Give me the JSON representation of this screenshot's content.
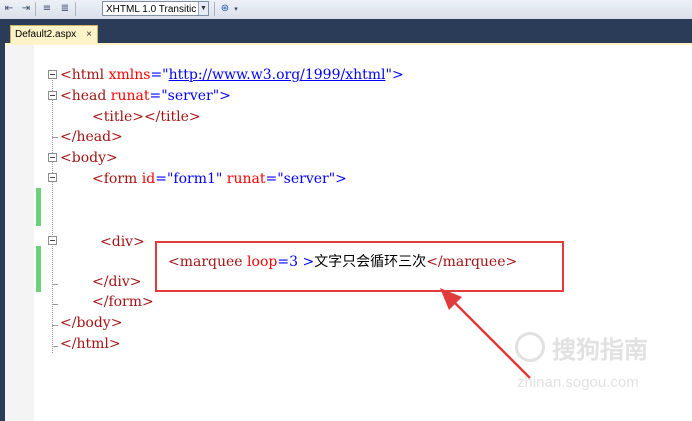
{
  "toolbar": {
    "doctype_value": "XHTML 1.0 Transitic",
    "icons": [
      "outdent-icon",
      "indent-icon",
      "comment-icon",
      "uncomment-icon",
      "validate-icon"
    ]
  },
  "tabs": [
    {
      "label": "Default2.aspx",
      "close": "×",
      "active": true
    }
  ],
  "code": {
    "l1": {
      "open": "<html ",
      "attr": "xmlns",
      "eq": "=\"",
      "url": "http://www.w3.org/1999/xhtml",
      "close": "\">"
    },
    "l2": {
      "open": "<head ",
      "attr": "runat",
      "eq": "=",
      "val": "\"server\"",
      "close": ">"
    },
    "l3": {
      "text": "<title></title>"
    },
    "l4": {
      "text": "</head>"
    },
    "l5": {
      "text": "<body>"
    },
    "l6": {
      "open": "<form ",
      "attr1": "id",
      "eq1": "=",
      "val1": "\"form1\"",
      "attr2": " runat",
      "eq2": "=",
      "val2": "\"server\"",
      "close": ">"
    },
    "l7": {
      "text": "<div>"
    },
    "l8": {
      "open": "<marquee ",
      "attr": "loop",
      "eq": "=",
      "val": "3",
      "close": " >",
      "content": "文字只会循环三次",
      "end": "</marquee>"
    },
    "l9": {
      "text": "</div>"
    },
    "l10": {
      "text": "</form>"
    },
    "l11": {
      "text": "</body>"
    },
    "l12": {
      "text": "</html>"
    }
  },
  "watermark": {
    "brand": "搜狗指南",
    "url": "zhinan.sogou.com"
  },
  "colors": {
    "tag": "#a31515",
    "attr": "#ff0000",
    "value": "#0000ff",
    "annotation": "#e03a3a",
    "change_bar": "#6ed07a"
  }
}
